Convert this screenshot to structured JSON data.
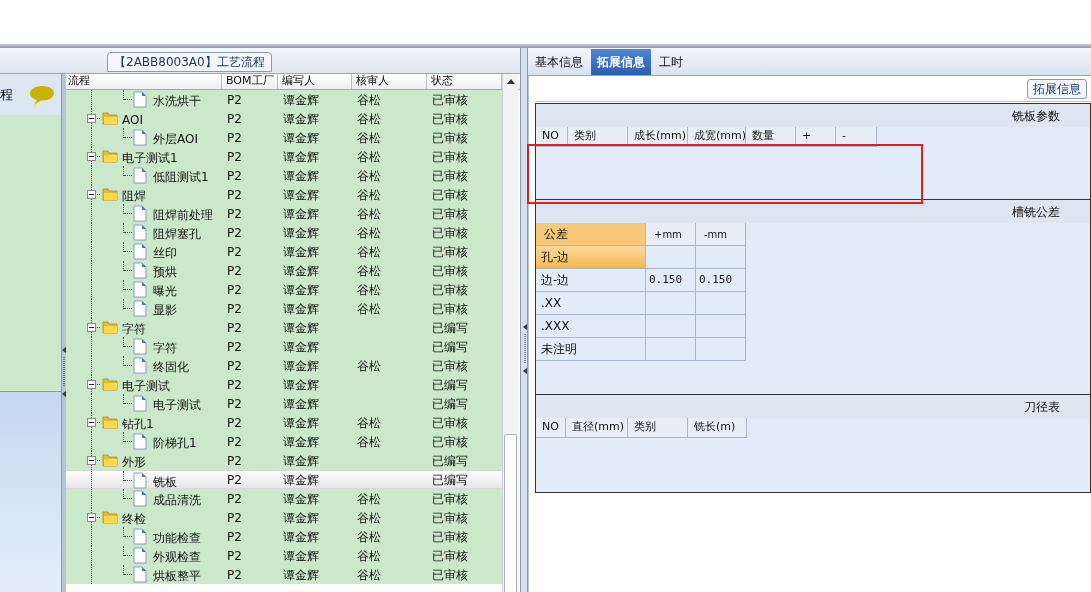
{
  "process_panel": {
    "title": "【2ABB8003A0】工艺流程"
  },
  "side_panel": {
    "title": "程"
  },
  "tree_grid": {
    "columns": [
      "流程",
      "BOM工厂",
      "编写人",
      "核审人",
      "状态"
    ],
    "rows": [
      {
        "kind": "file",
        "label": "水洗烘干",
        "bom": "P2",
        "author": "谭金辉",
        "reviewer": "谷松",
        "status": "已审核",
        "selected": false
      },
      {
        "kind": "folder",
        "label": "AOI",
        "bom": "P2",
        "author": "谭金辉",
        "reviewer": "谷松",
        "status": "已审核",
        "selected": false,
        "expanded": true,
        "children": [
          {
            "kind": "file",
            "label": "外层AOI",
            "bom": "P2",
            "author": "谭金辉",
            "reviewer": "谷松",
            "status": "已审核",
            "selected": false
          }
        ]
      },
      {
        "kind": "folder",
        "label": "电子测试1",
        "bom": "P2",
        "author": "谭金辉",
        "reviewer": "谷松",
        "status": "已审核",
        "selected": false,
        "expanded": true,
        "children": [
          {
            "kind": "file",
            "label": "低阻测试1",
            "bom": "P2",
            "author": "谭金辉",
            "reviewer": "谷松",
            "status": "已审核",
            "selected": false
          }
        ]
      },
      {
        "kind": "folder",
        "label": "阻焊",
        "bom": "P2",
        "author": "谭金辉",
        "reviewer": "谷松",
        "status": "已审核",
        "selected": false,
        "expanded": true,
        "children": [
          {
            "kind": "file",
            "label": "阻焊前处理",
            "bom": "P2",
            "author": "谭金辉",
            "reviewer": "谷松",
            "status": "已审核",
            "selected": false
          },
          {
            "kind": "file",
            "label": "阻焊塞孔",
            "bom": "P2",
            "author": "谭金辉",
            "reviewer": "谷松",
            "status": "已审核",
            "selected": false
          },
          {
            "kind": "file",
            "label": "丝印",
            "bom": "P2",
            "author": "谭金辉",
            "reviewer": "谷松",
            "status": "已审核",
            "selected": false
          },
          {
            "kind": "file",
            "label": "预烘",
            "bom": "P2",
            "author": "谭金辉",
            "reviewer": "谷松",
            "status": "已审核",
            "selected": false
          },
          {
            "kind": "file",
            "label": "曝光",
            "bom": "P2",
            "author": "谭金辉",
            "reviewer": "谷松",
            "status": "已审核",
            "selected": false
          },
          {
            "kind": "file",
            "label": "显影",
            "bom": "P2",
            "author": "谭金辉",
            "reviewer": "谷松",
            "status": "已审核",
            "selected": false
          }
        ]
      },
      {
        "kind": "folder",
        "label": "字符",
        "bom": "P2",
        "author": "谭金辉",
        "status": "已编写",
        "selected": false,
        "expanded": true,
        "children": [
          {
            "kind": "file",
            "label": "字符",
            "bom": "P2",
            "author": "谭金辉",
            "status": "已编写",
            "selected": false
          },
          {
            "kind": "file",
            "label": "终固化",
            "bom": "P2",
            "author": "谭金辉",
            "reviewer": "谷松",
            "status": "已审核",
            "selected": false
          }
        ]
      },
      {
        "kind": "folder",
        "label": "电子测试",
        "bom": "P2",
        "author": "谭金辉",
        "status": "已编写",
        "selected": false,
        "expanded": true,
        "children": [
          {
            "kind": "file",
            "label": "电子测试",
            "bom": "P2",
            "author": "谭金辉",
            "status": "已编写",
            "selected": false
          }
        ]
      },
      {
        "kind": "folder",
        "label": "钻孔1",
        "bom": "P2",
        "author": "谭金辉",
        "reviewer": "谷松",
        "status": "已审核",
        "selected": false,
        "expanded": true,
        "children": [
          {
            "kind": "file",
            "label": "阶梯孔1",
            "bom": "P2",
            "author": "谭金辉",
            "reviewer": "谷松",
            "status": "已审核",
            "selected": false
          }
        ]
      },
      {
        "kind": "folder",
        "label": "外形",
        "bom": "P2",
        "author": "谭金辉",
        "status": "已编写",
        "selected": false,
        "expanded": true,
        "children": [
          {
            "kind": "file",
            "label": "铣板",
            "bom": "P2",
            "author": "谭金辉",
            "status": "已编写",
            "selected": true
          },
          {
            "kind": "file",
            "label": "成品清洗",
            "bom": "P2",
            "author": "谭金辉",
            "reviewer": "谷松",
            "status": "已审核",
            "selected": false
          }
        ]
      },
      {
        "kind": "folder",
        "label": "终检",
        "bom": "P2",
        "author": "谭金辉",
        "reviewer": "谷松",
        "status": "已审核",
        "selected": false,
        "expanded": true,
        "children": [
          {
            "kind": "file",
            "label": "功能检查",
            "bom": "P2",
            "author": "谭金辉",
            "reviewer": "谷松",
            "status": "已审核",
            "selected": false
          },
          {
            "kind": "file",
            "label": "外观检查",
            "bom": "P2",
            "author": "谭金辉",
            "reviewer": "谷松",
            "status": "已审核",
            "selected": false
          },
          {
            "kind": "file",
            "label": "烘板整平",
            "bom": "P2",
            "author": "谭金辉",
            "reviewer": "谷松",
            "status": "已审核",
            "selected": false
          }
        ]
      }
    ]
  },
  "detail_tabs": [
    {
      "label": "基本信息",
      "selected": false
    },
    {
      "label": "拓展信息",
      "selected": true
    },
    {
      "label": "工时",
      "selected": false
    }
  ],
  "group_title": "拓展信息",
  "board_params": {
    "title": "铣板参数",
    "columns": [
      "NO",
      "类别",
      "成长(mm)",
      "成宽(mm)",
      "数量",
      "+",
      "-"
    ]
  },
  "slot_tolerance": {
    "title": "槽铣公差",
    "columns": [
      "公差",
      "+mm",
      "-mm"
    ],
    "rows": [
      {
        "label": "孔-边",
        "plus": "",
        "minus": "",
        "selected": true
      },
      {
        "label": "边-边",
        "plus": "0.150",
        "minus": "0.150",
        "selected": false
      },
      {
        "label": ".XX",
        "plus": "",
        "minus": "",
        "selected": false
      },
      {
        "label": ".XXX",
        "plus": "",
        "minus": "",
        "selected": false
      },
      {
        "label": "未注明",
        "plus": "",
        "minus": "",
        "selected": false
      }
    ]
  },
  "tool_table": {
    "title": "刀径表",
    "columns": [
      "NO",
      "直径(mm)",
      "类别",
      "铣长(m)"
    ]
  }
}
